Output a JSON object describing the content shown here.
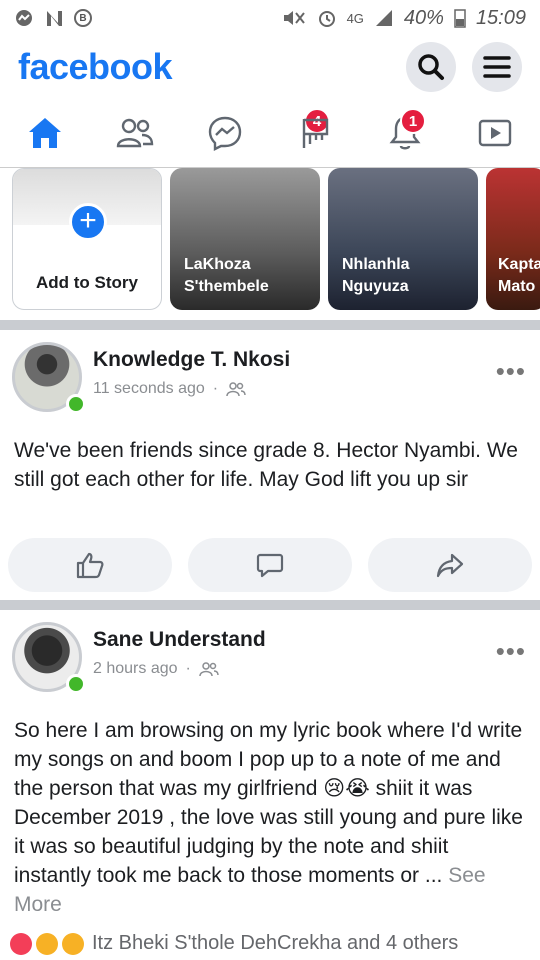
{
  "status_bar": {
    "network_type": "4G",
    "battery": "40%",
    "time": "15:09"
  },
  "header": {
    "logo": "facebook"
  },
  "nav": {
    "messenger_badge": "4",
    "notifications_badge": "1"
  },
  "stories": {
    "add_label": "Add to Story",
    "items": [
      {
        "line1": "LaKhoza",
        "line2": "S'thembele"
      },
      {
        "line1": "Nhlanhla",
        "line2": "Nguyuza"
      },
      {
        "line1": "Kapta",
        "line2": "Mato"
      }
    ]
  },
  "posts": [
    {
      "author": "Knowledge T. Nkosi",
      "time": "11 seconds ago",
      "text": "We've been friends since grade 8. Hector Nyambi. We still got each other for life. May God lift you up sir"
    },
    {
      "author": "Sane Understand",
      "time": "2 hours ago",
      "text": "So here I am browsing on my lyric book where I'd write my songs on and boom I pop up to a note of me and the person that was my girlfriend 😢😭 shiit it was December 2019 , the love was still young and pure like it was so beautiful judging by the note and shiit instantly took me back to those moments or ...",
      "see_more": "See More",
      "reactions_text": "Itz Bheki S'thole DehCrekha and 4 others"
    }
  ],
  "colors": {
    "brand": "#1877f2",
    "badge": "#e41e3f",
    "online": "#42b72a"
  }
}
